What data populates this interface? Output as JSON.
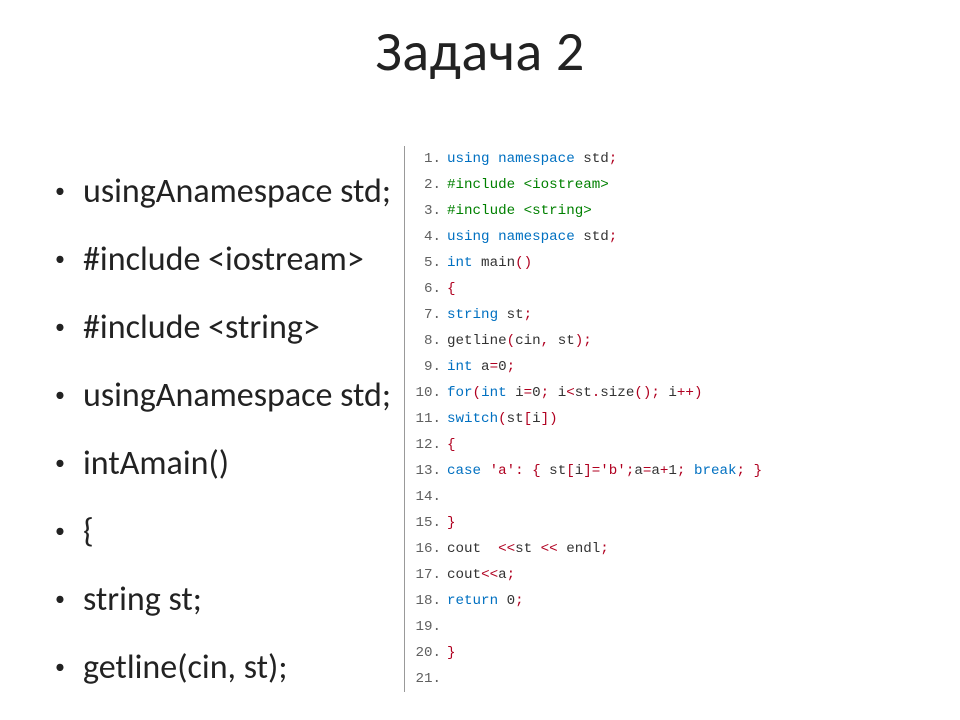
{
  "title": "Задача 2",
  "bullets": [
    "usingАnamespace std;",
    "#include <iostream>",
    "#include <string>",
    "usingАnamespace std;",
    "intАmain()",
    "{",
    "string st;",
    "getline(cin, st);"
  ],
  "code": {
    "lines": [
      {
        "n": "1",
        "seg": [
          {
            "c": "kw",
            "t": "using namespace"
          },
          {
            "c": "plain",
            "t": " std"
          },
          {
            "c": "op",
            "t": ";"
          }
        ]
      },
      {
        "n": "2",
        "seg": [
          {
            "c": "pp",
            "t": "#include <iostream>"
          }
        ]
      },
      {
        "n": "3",
        "seg": [
          {
            "c": "pp",
            "t": "#include <string>"
          }
        ]
      },
      {
        "n": "4",
        "seg": [
          {
            "c": "kw",
            "t": "using namespace"
          },
          {
            "c": "plain",
            "t": " std"
          },
          {
            "c": "op",
            "t": ";"
          }
        ]
      },
      {
        "n": "5",
        "seg": [
          {
            "c": "kw",
            "t": "int"
          },
          {
            "c": "plain",
            "t": " main"
          },
          {
            "c": "op",
            "t": "()"
          }
        ]
      },
      {
        "n": "6",
        "seg": [
          {
            "c": "op",
            "t": "{"
          }
        ]
      },
      {
        "n": "7",
        "seg": [
          {
            "c": "kw",
            "t": "string"
          },
          {
            "c": "plain",
            "t": " st"
          },
          {
            "c": "op",
            "t": ";"
          }
        ]
      },
      {
        "n": "8",
        "seg": [
          {
            "c": "plain",
            "t": "getline"
          },
          {
            "c": "op",
            "t": "("
          },
          {
            "c": "plain",
            "t": "cin"
          },
          {
            "c": "op",
            "t": ","
          },
          {
            "c": "plain",
            "t": " st"
          },
          {
            "c": "op",
            "t": ");"
          }
        ]
      },
      {
        "n": "9",
        "seg": [
          {
            "c": "kw",
            "t": "int"
          },
          {
            "c": "plain",
            "t": " a"
          },
          {
            "c": "op",
            "t": "="
          },
          {
            "c": "plain",
            "t": "0"
          },
          {
            "c": "op",
            "t": ";"
          }
        ]
      },
      {
        "n": "10",
        "seg": [
          {
            "c": "kw",
            "t": "for"
          },
          {
            "c": "op",
            "t": "("
          },
          {
            "c": "kw",
            "t": "int"
          },
          {
            "c": "plain",
            "t": " i"
          },
          {
            "c": "op",
            "t": "="
          },
          {
            "c": "plain",
            "t": "0"
          },
          {
            "c": "op",
            "t": ";"
          },
          {
            "c": "plain",
            "t": " i"
          },
          {
            "c": "op",
            "t": "<"
          },
          {
            "c": "plain",
            "t": "st"
          },
          {
            "c": "op",
            "t": "."
          },
          {
            "c": "plain",
            "t": "size"
          },
          {
            "c": "op",
            "t": "();"
          },
          {
            "c": "plain",
            "t": " i"
          },
          {
            "c": "op",
            "t": "++)"
          }
        ]
      },
      {
        "n": "11",
        "seg": [
          {
            "c": "kw",
            "t": "switch"
          },
          {
            "c": "op",
            "t": "("
          },
          {
            "c": "plain",
            "t": "st"
          },
          {
            "c": "op",
            "t": "["
          },
          {
            "c": "plain",
            "t": "i"
          },
          {
            "c": "op",
            "t": "])"
          }
        ]
      },
      {
        "n": "12",
        "seg": [
          {
            "c": "op",
            "t": "{"
          }
        ]
      },
      {
        "n": "13",
        "seg": [
          {
            "c": "kw",
            "t": "case"
          },
          {
            "c": "plain",
            "t": " "
          },
          {
            "c": "str",
            "t": "'a'"
          },
          {
            "c": "op",
            "t": ":"
          },
          {
            "c": "plain",
            "t": " "
          },
          {
            "c": "op",
            "t": "{"
          },
          {
            "c": "plain",
            "t": " st"
          },
          {
            "c": "op",
            "t": "["
          },
          {
            "c": "plain",
            "t": "i"
          },
          {
            "c": "op",
            "t": "]="
          },
          {
            "c": "str",
            "t": "'b'"
          },
          {
            "c": "op",
            "t": ";"
          },
          {
            "c": "plain",
            "t": "a"
          },
          {
            "c": "op",
            "t": "="
          },
          {
            "c": "plain",
            "t": "a"
          },
          {
            "c": "op",
            "t": "+"
          },
          {
            "c": "plain",
            "t": "1"
          },
          {
            "c": "op",
            "t": ";"
          },
          {
            "c": "plain",
            "t": " "
          },
          {
            "c": "kw",
            "t": "break"
          },
          {
            "c": "op",
            "t": ";"
          },
          {
            "c": "plain",
            "t": " "
          },
          {
            "c": "op",
            "t": "}"
          }
        ]
      },
      {
        "n": "14",
        "seg": []
      },
      {
        "n": "15",
        "seg": [
          {
            "c": "op",
            "t": "}"
          }
        ]
      },
      {
        "n": "16",
        "seg": [
          {
            "c": "plain",
            "t": "cout  "
          },
          {
            "c": "op",
            "t": "<<"
          },
          {
            "c": "plain",
            "t": "st "
          },
          {
            "c": "op",
            "t": "<<"
          },
          {
            "c": "plain",
            "t": " endl"
          },
          {
            "c": "op",
            "t": ";"
          }
        ]
      },
      {
        "n": "17",
        "seg": [
          {
            "c": "plain",
            "t": "cout"
          },
          {
            "c": "op",
            "t": "<<"
          },
          {
            "c": "plain",
            "t": "a"
          },
          {
            "c": "op",
            "t": ";"
          }
        ]
      },
      {
        "n": "18",
        "seg": [
          {
            "c": "kw",
            "t": "return"
          },
          {
            "c": "plain",
            "t": " 0"
          },
          {
            "c": "op",
            "t": ";"
          }
        ]
      },
      {
        "n": "19",
        "seg": []
      },
      {
        "n": "20",
        "seg": [
          {
            "c": "op",
            "t": "}"
          }
        ]
      },
      {
        "n": "21",
        "seg": []
      }
    ]
  }
}
